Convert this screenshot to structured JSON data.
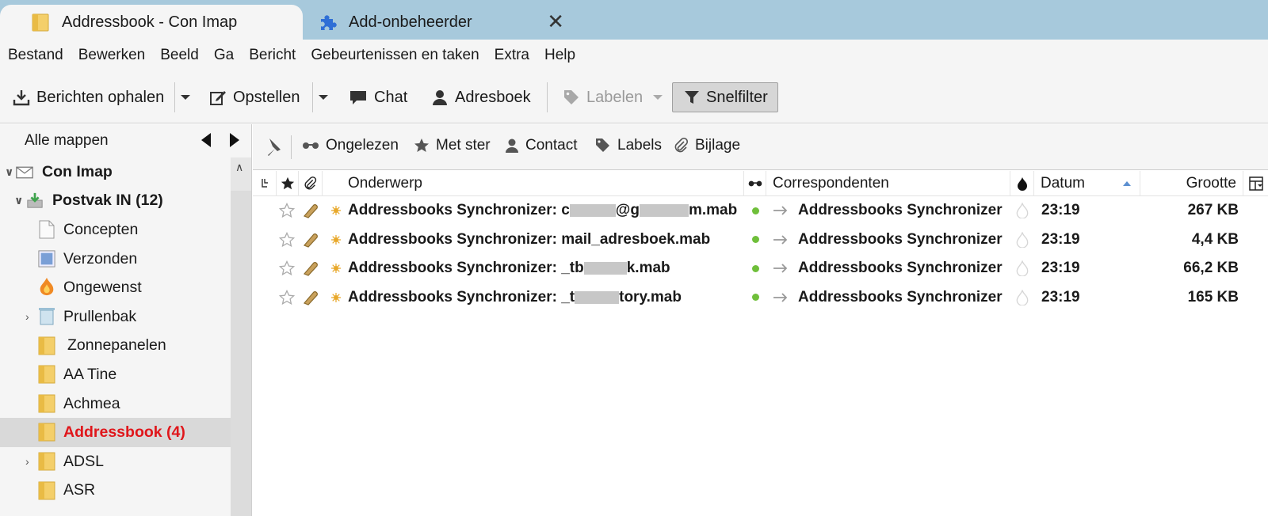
{
  "tabs": [
    {
      "label": "Addressbook - Con Imap",
      "icon": "folder-icon"
    },
    {
      "label": "Add-onbeheerder",
      "icon": "puzzle-icon"
    }
  ],
  "menu": [
    "Bestand",
    "Bewerken",
    "Beeld",
    "Ga",
    "Bericht",
    "Gebeurtenissen en taken",
    "Extra",
    "Help"
  ],
  "toolbar": {
    "get_messages": "Berichten ophalen",
    "compose": "Opstellen",
    "chat": "Chat",
    "addressbook": "Adresboek",
    "tags": "Labelen",
    "quickfilter": "Snelfilter"
  },
  "folder_pane": {
    "header": "Alle mappen",
    "folders": [
      {
        "label": "Con Imap",
        "icon": "mail-account-icon",
        "expanded": true
      },
      {
        "label": "Postvak IN (12)",
        "icon": "inbox-icon",
        "expanded": true
      },
      {
        "label": "Concepten",
        "icon": "drafts-icon"
      },
      {
        "label": "Verzonden",
        "icon": "sent-icon"
      },
      {
        "label": "Ongewenst",
        "icon": "junk-icon"
      },
      {
        "label": "Prullenbak",
        "icon": "trash-icon",
        "collapsed": true
      },
      {
        "label": "Zonnepanelen",
        "icon": "folder-icon"
      },
      {
        "label": "AA Tine",
        "icon": "folder-icon"
      },
      {
        "label": "Achmea",
        "icon": "folder-icon"
      },
      {
        "label": "Addressbook (4)",
        "icon": "folder-icon",
        "selected": true
      },
      {
        "label": "ADSL",
        "icon": "folder-icon",
        "collapsed": true
      },
      {
        "label": "ASR",
        "icon": "folder-icon"
      }
    ]
  },
  "quick_filter": {
    "unread": "Ongelezen",
    "starred": "Met ster",
    "contact": "Contact",
    "tags": "Labels",
    "attachment": "Bijlage"
  },
  "columns": {
    "subject": "Onderwerp",
    "correspondents": "Correspondenten",
    "date": "Datum",
    "size": "Grootte"
  },
  "messages": [
    {
      "subject_prefix": "Addressbooks Synchronizer: c",
      "subject_middle": "@g",
      "subject_suffix": "m.mab",
      "correspondent": "Addressbooks Synchronizer",
      "date": "23:19",
      "size": "267 KB"
    },
    {
      "subject_prefix": "Addressbooks Synchronizer: mail_adresboek.mab",
      "subject_middle": "",
      "subject_suffix": "",
      "correspondent": "Addressbooks Synchronizer",
      "date": "23:19",
      "size": "4,4 KB"
    },
    {
      "subject_prefix": "Addressbooks Synchronizer: _tb",
      "subject_middle": "",
      "subject_suffix": "k.mab",
      "correspondent": "Addressbooks Synchronizer",
      "date": "23:19",
      "size": "66,2 KB"
    },
    {
      "subject_prefix": "Addressbooks Synchronizer: _t",
      "subject_middle": "",
      "subject_suffix": "tory.mab",
      "correspondent": "Addressbooks Synchronizer",
      "date": "23:19",
      "size": "165 KB"
    }
  ],
  "colors": {
    "tabbar": "#a7c9dc",
    "selected_folder_text": "#e0161b",
    "unread_dot": "#6fbf3a"
  }
}
